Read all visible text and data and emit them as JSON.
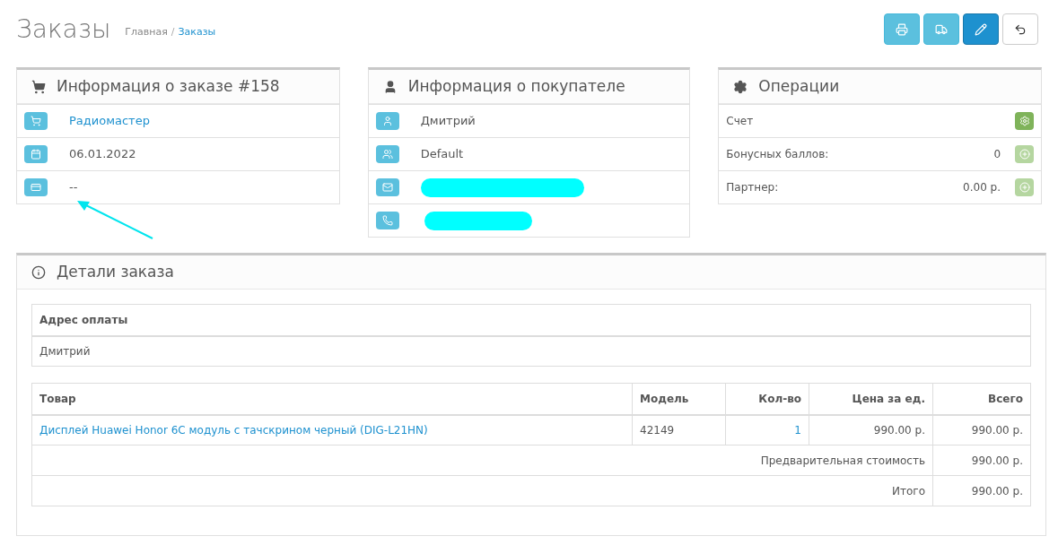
{
  "header": {
    "title": "Заказы",
    "breadcrumbs": [
      {
        "label": "Главная",
        "current": false
      },
      {
        "label": "Заказы",
        "current": true
      }
    ],
    "separator": "/"
  },
  "toolbar": [
    {
      "kind": "info"
    },
    {
      "kind": "info"
    },
    {
      "kind": "primary"
    },
    {
      "kind": "default"
    }
  ],
  "order_info": {
    "title": "Информация о заказе #158",
    "rows": [
      {
        "kind": "link",
        "text": "Радиомастер"
      },
      {
        "kind": "text",
        "text": "06.01.2022"
      },
      {
        "kind": "text",
        "text": "--"
      }
    ]
  },
  "customer": {
    "title": "Информация о покупателе",
    "rows": [
      {
        "kind": "text",
        "text": "Дмитрий"
      },
      {
        "kind": "text",
        "text": "Default"
      },
      {
        "kind": "redacted"
      },
      {
        "kind": "redacted"
      }
    ]
  },
  "operations": {
    "title": "Операции",
    "rows": [
      {
        "label": "Счет",
        "disabled": false
      },
      {
        "label": "Бонусных баллов:",
        "value": "0",
        "disabled": true
      },
      {
        "label": "Партнер:",
        "value": "0.00 р.",
        "disabled": true
      }
    ]
  },
  "details": {
    "title": "Детали заказа",
    "address": {
      "heading": "Адрес оплаты",
      "value": "Дмитрий"
    },
    "table": {
      "columns": [
        {
          "label": "Товар"
        },
        {
          "label": "Модель"
        },
        {
          "label": "Кол-во"
        },
        {
          "label": "Цена за ед."
        },
        {
          "label": "Всего"
        }
      ],
      "rows": [
        {
          "product": "Дисплей Huawei Honor 6C модуль с тачскрином черный (DIG-L21HN)",
          "model": "42149",
          "quantity": "1",
          "price": "990.00 р.",
          "total": "990.00 р."
        }
      ],
      "totals": [
        {
          "label": "Предварительная стоимость",
          "value": "990.00 р."
        },
        {
          "label": "Итого",
          "value": "990.00 р."
        }
      ]
    }
  }
}
